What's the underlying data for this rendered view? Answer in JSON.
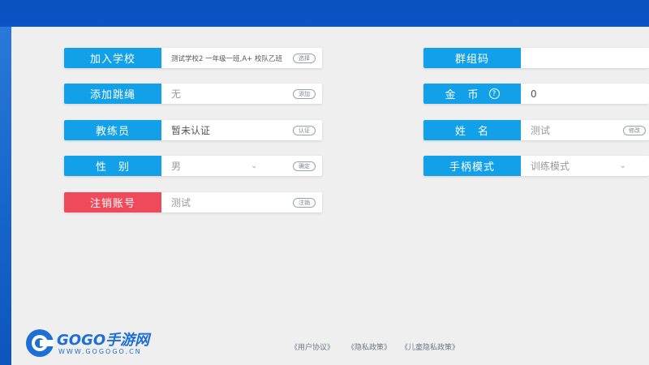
{
  "left_fields": [
    {
      "label": "加入学校",
      "value": "测试学校2 一年级一班,A+ 校队乙班",
      "button": "选择"
    },
    {
      "label": "添加跳绳",
      "value": "无",
      "button": "添加"
    },
    {
      "label": "教练员",
      "value": "暂未认证",
      "button": "认证"
    },
    {
      "label": "性　别",
      "value": "男",
      "button": "确定"
    },
    {
      "label": "注销账号",
      "value": "测试",
      "button": "注销"
    }
  ],
  "right_fields": [
    {
      "label": "群组码",
      "value": ""
    },
    {
      "label": "金　币",
      "value": "0"
    },
    {
      "label": "姓　名",
      "value": "测试",
      "button": "修改"
    },
    {
      "label": "手柄模式",
      "value": "训练模式"
    }
  ],
  "coin_help_icon": "question-circle-icon",
  "footer": {
    "user_agreement": "《用户协议》",
    "privacy_policy": "《隐私政策》",
    "child_privacy": "《儿童隐私政策》"
  },
  "watermark": {
    "brand": "GOGO手游网",
    "url": "WWW.GOGOGO.CN"
  },
  "colors": {
    "label_blue": "#12a0e8",
    "label_red": "#ef4a5b",
    "topbar": "#0b55c6"
  }
}
